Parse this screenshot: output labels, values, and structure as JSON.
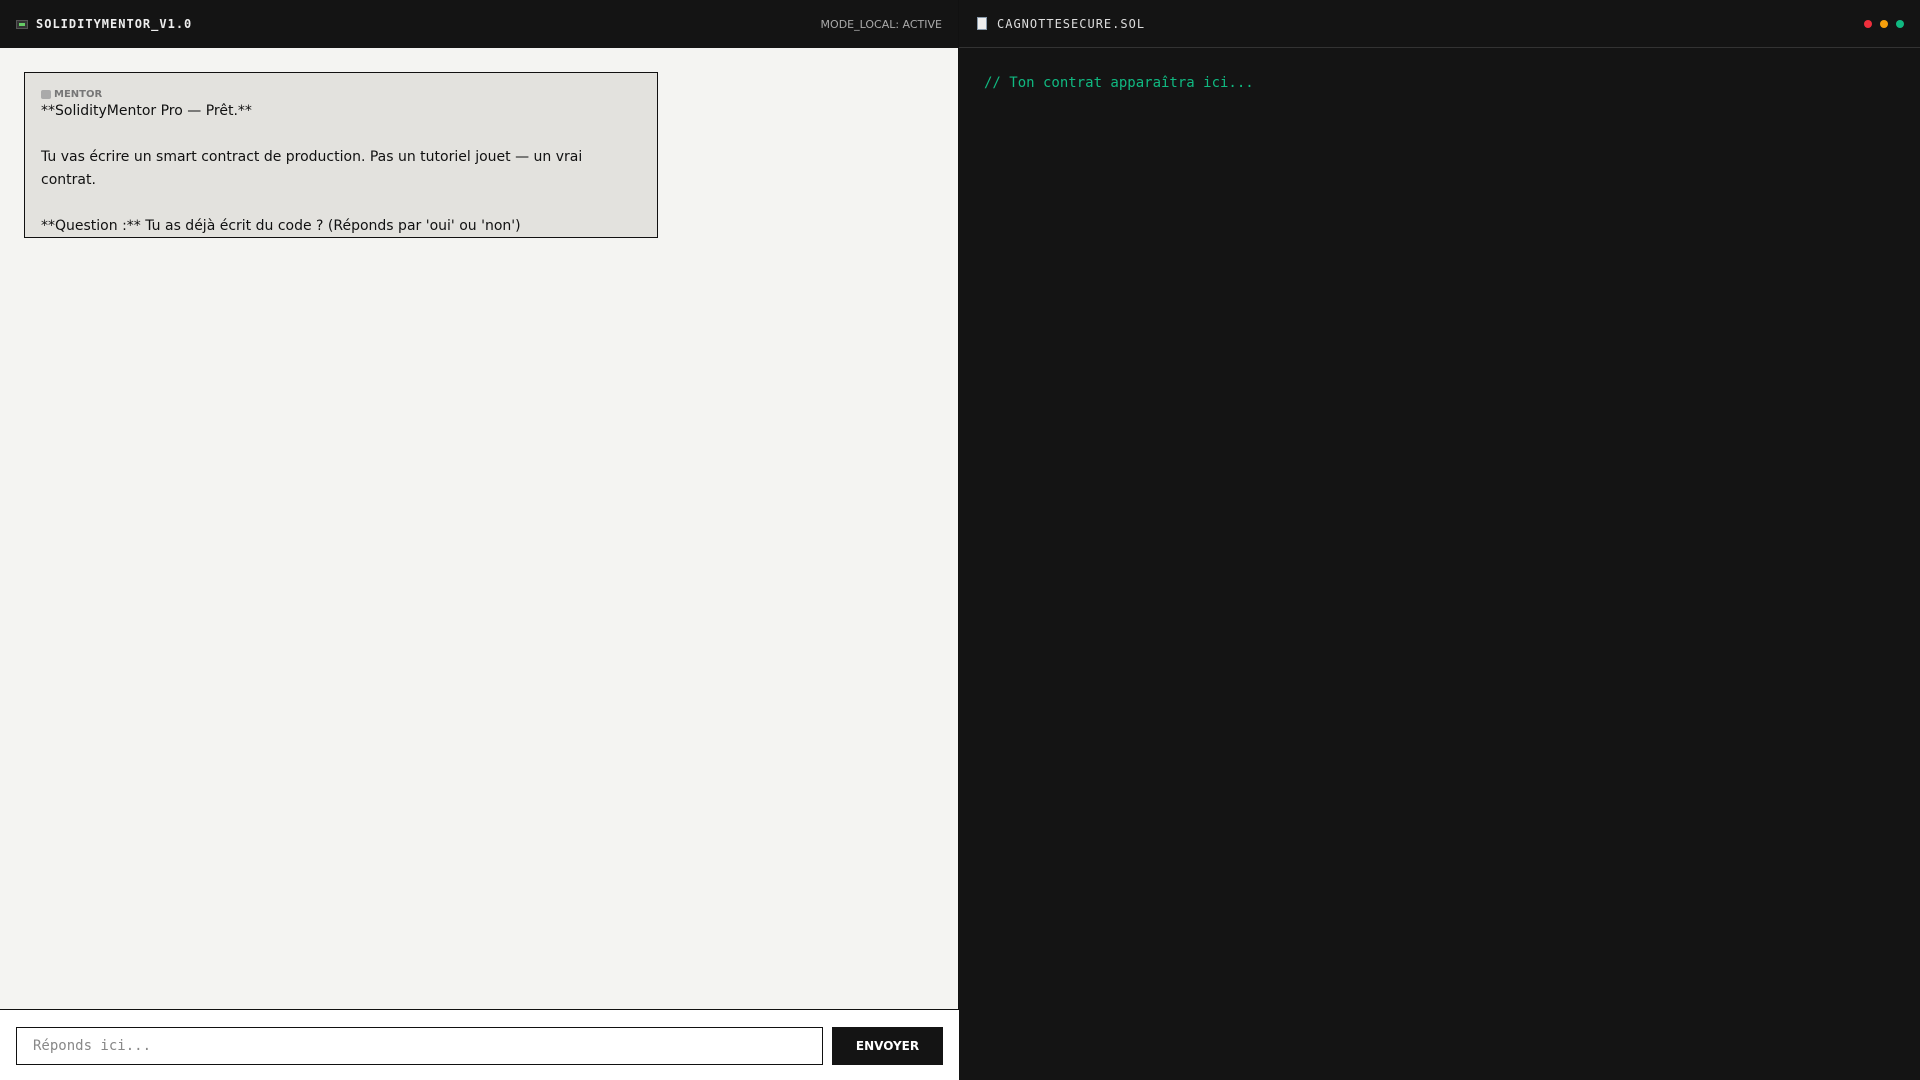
{
  "app": {
    "title": "SOLIDITYMENTOR_V1.0",
    "mode": "MODE_LOCAL: ACTIVE"
  },
  "chat": {
    "messages": [
      {
        "sender": "MENTOR",
        "lines": [
          "**SolidityMentor Pro — Prêt.**",
          "Tu vas écrire un smart contract de production. Pas un tutoriel jouet — un vrai contrat.",
          "**Question :** Tu as déjà écrit du code ? (Réponds par 'oui' ou 'non')"
        ]
      }
    ],
    "input_placeholder": "Réponds ici...",
    "input_value": "",
    "send_label": "ENVOYER"
  },
  "editor": {
    "filename": "CAGNOTTESECURE.SOL",
    "placeholder": "// Ton contrat apparaîtra ici...",
    "dot_colors": [
      "#ef2f3c",
      "#f59e0b",
      "#10b981"
    ]
  }
}
